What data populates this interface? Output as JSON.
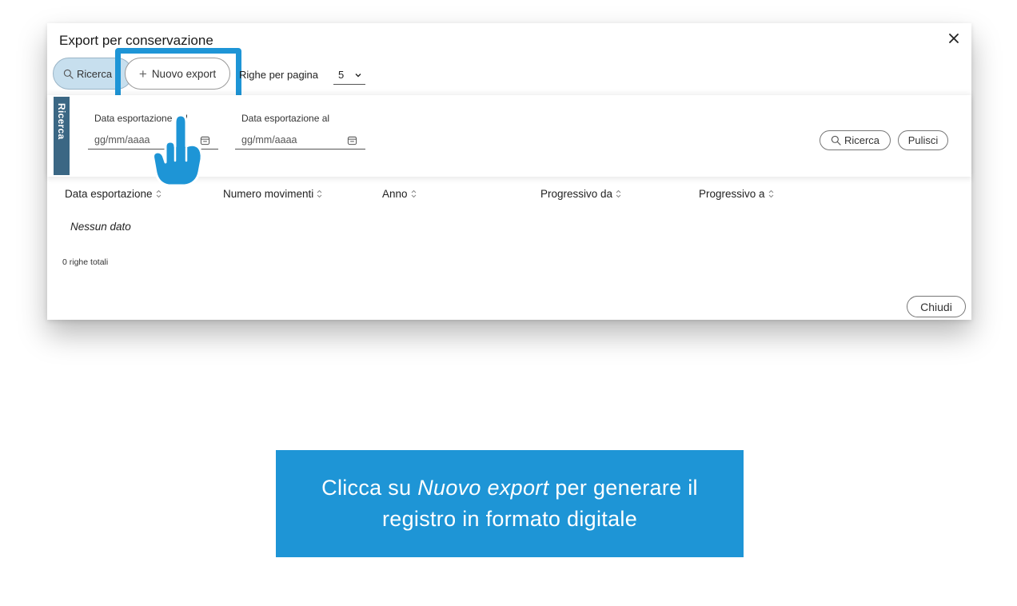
{
  "dialog": {
    "title": "Export per conservazione"
  },
  "toolbar": {
    "search_label": "Ricerca",
    "new_export_plus": "+",
    "new_export_label": "Nuovo export",
    "rows_per_page_label": "Righe per pagina",
    "rows_per_page_value": "5"
  },
  "filter": {
    "panel_tab_label": "Ricerca",
    "date_from_label": "Data esportazione dal",
    "date_from_placeholder": "gg/mm/aaaa",
    "date_to_label": "Data esportazione al",
    "date_to_placeholder": "gg/mm/aaaa",
    "search_button": "Ricerca",
    "clear_button": "Pulisci"
  },
  "table": {
    "columns": [
      "Data esportazione",
      "Numero movimenti",
      "Anno",
      "Progressivo da",
      "Progressivo a"
    ],
    "empty_message": "Nessun dato",
    "total_rows": "0 righe totali"
  },
  "footer": {
    "close_button": "Chiudi"
  },
  "caption": {
    "line1_before": "Clicca su",
    "line1_emphasis": "Nuovo export",
    "line1_after": "per generare il",
    "line2": "registro in formato digitale"
  },
  "colors": {
    "accent_blue": "#1e95d6",
    "search_pill_bg": "#c7dfee",
    "panel_tab_bg": "#3b6784"
  },
  "icons": [
    "close-icon",
    "search-icon",
    "plus-icon",
    "chevron-down-icon",
    "calendar-icon",
    "sort-icon",
    "pointing-hand-icon"
  ]
}
